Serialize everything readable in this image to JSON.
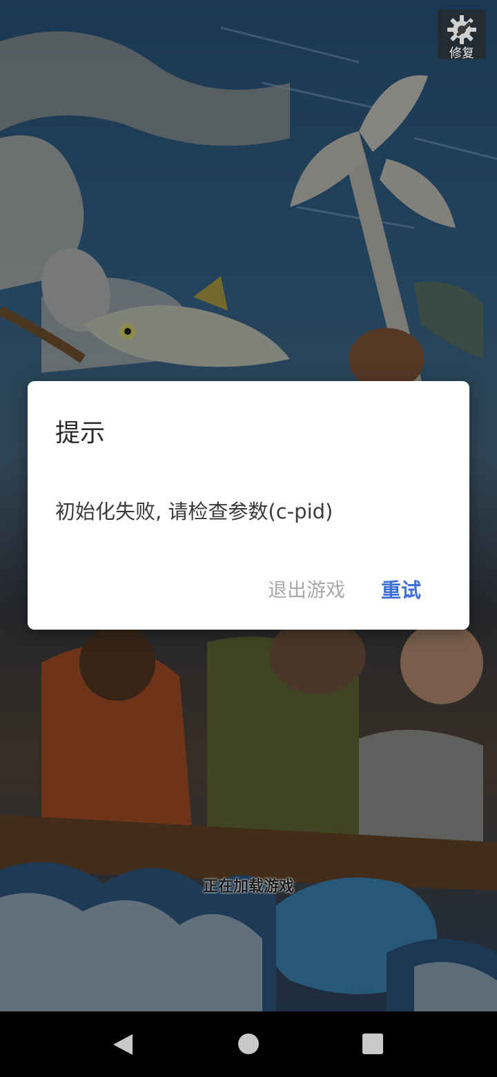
{
  "repair_button": {
    "label": "修复",
    "icon": "gear-wrench-icon"
  },
  "dialog": {
    "title": "提示",
    "message": "初始化失败, 请检查参数(c-pid)",
    "exit_label": "退出游戏",
    "retry_label": "重试",
    "retry_color": "#3f6fd9",
    "exit_color": "#a9a9a9"
  },
  "loading_text": "正在加载游戏",
  "nav": {
    "back_icon": "back-triangle-icon",
    "home_icon": "home-circle-icon",
    "recent_icon": "recent-square-icon"
  }
}
